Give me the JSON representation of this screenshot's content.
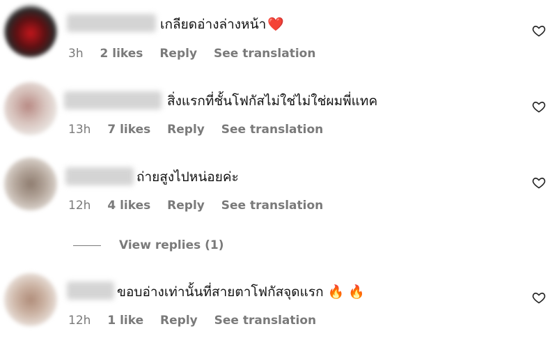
{
  "comments": [
    {
      "text": "เกลียดอ่างล่างหน้า",
      "emoji": "❤️",
      "time": "3h",
      "likes": "2 likes",
      "reply": "Reply",
      "translate": "See translation"
    },
    {
      "text": "สิ่งแรกที่ชั้นโฟกัสไม่ใช่ไม่ใช่ผมพี่แทค",
      "emoji": "",
      "time": "13h",
      "likes": "7 likes",
      "reply": "Reply",
      "translate": "See translation"
    },
    {
      "text": "ถ่ายสูงไปหน่อยค่ะ",
      "emoji": "",
      "time": "12h",
      "likes": "4 likes",
      "reply": "Reply",
      "translate": "See translation"
    },
    {
      "text": "ขอบอ่างเท่านั้นที่สายตาโฟกัสจุดแรก",
      "emoji": "🔥 🔥",
      "time": "12h",
      "likes": "1 like",
      "reply": "Reply",
      "translate": "See translation"
    }
  ],
  "view_replies": "View replies (1)",
  "icons": {
    "like": "heart-outline-icon",
    "emoji_heart": "red-heart-emoji",
    "emoji_fire": "fire-emoji"
  },
  "colors": {
    "meta": "#7a7a7a",
    "text": "#111111",
    "heart_emoji": "#e0245e",
    "fire": "#f28a1f"
  }
}
